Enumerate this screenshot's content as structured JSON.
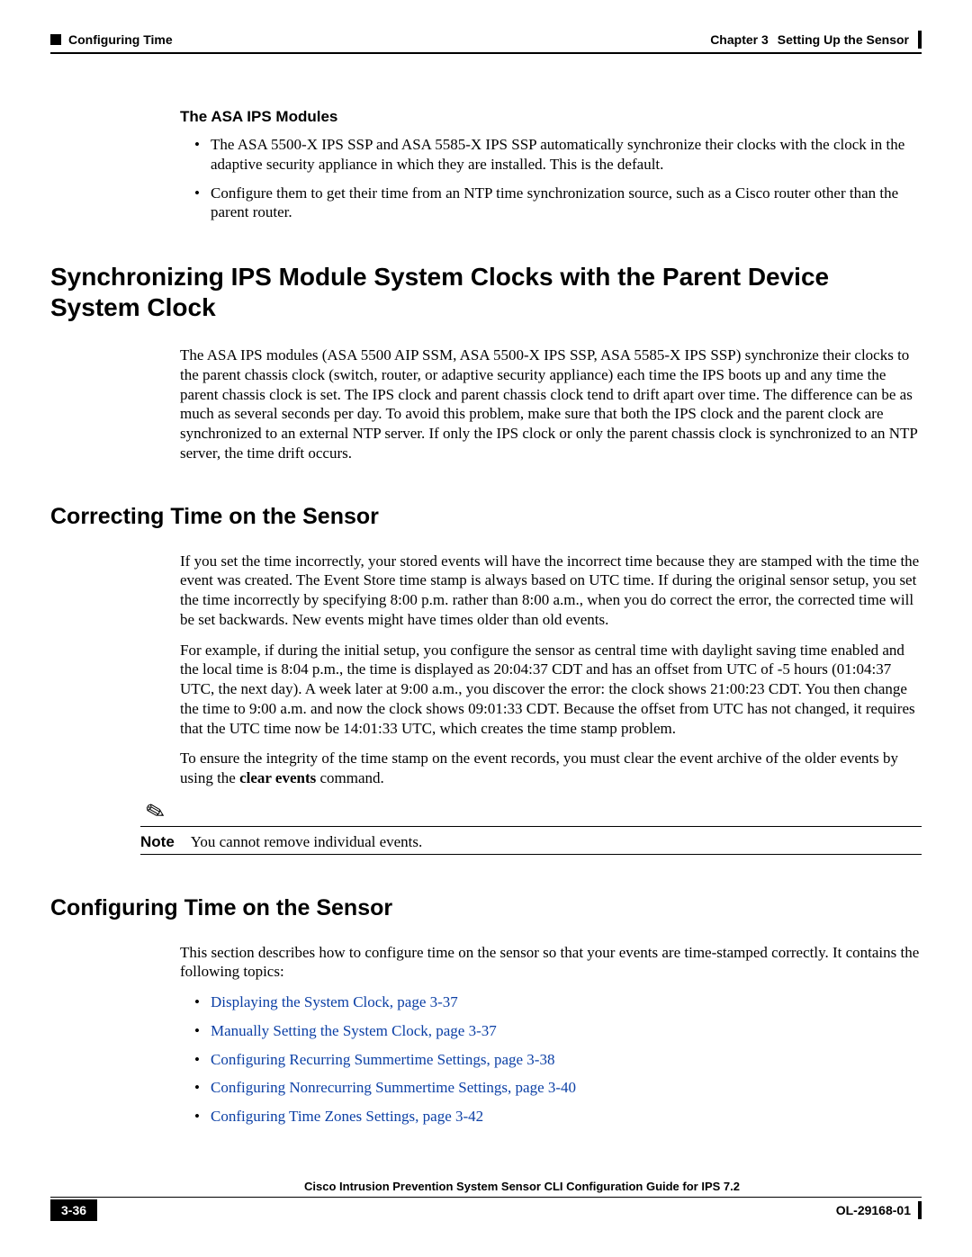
{
  "header": {
    "left_marker": "Configuring Time",
    "chapter_label": "Chapter 3",
    "chapter_title": "Setting Up the Sensor"
  },
  "asa_section": {
    "heading": "The ASA IPS Modules",
    "bullets": [
      "The ASA 5500-X IPS SSP and ASA 5585-X IPS SSP automatically synchronize their clocks with the clock in the adaptive security appliance in which they are installed. This is the default.",
      "Configure them to get their time from an NTP time synchronization source, such as a Cisco router other than the parent router."
    ]
  },
  "sync_section": {
    "heading": "Synchronizing IPS Module System Clocks with the Parent Device System Clock",
    "para": "The ASA IPS modules (ASA 5500 AIP SSM, ASA 5500-X IPS SSP, ASA 5585-X IPS SSP) synchronize their clocks to the parent chassis clock (switch, router, or adaptive security appliance) each time the IPS boots up and any time the parent chassis clock is set. The IPS clock and parent chassis clock tend to drift apart over time. The difference can be as much as several seconds per day. To avoid this problem, make sure that both the IPS clock and the parent clock are synchronized to an external NTP server. If only the IPS clock or only the parent chassis clock is synchronized to an NTP server, the time drift occurs."
  },
  "correcting_section": {
    "heading": "Correcting Time on the Sensor",
    "para1": "If you set the time incorrectly, your stored events will have the incorrect time because they are stamped with the time the event was created. The Event Store time stamp is always based on UTC time. If during the original sensor setup, you set the time incorrectly by specifying 8:00 p.m. rather than 8:00 a.m., when you do correct the error, the corrected time will be set backwards. New events might have times older than old events.",
    "para2": "For example, if during the initial setup, you configure the sensor as central time with daylight saving time enabled and the local time is 8:04 p.m., the time is displayed as 20:04:37 CDT and has an offset from UTC of -5 hours (01:04:37 UTC, the next day). A week later at 9:00 a.m., you discover the error: the clock shows 21:00:23 CDT. You then change the time to 9:00 a.m. and now the clock shows 09:01:33 CDT. Because the offset from UTC has not changed, it requires that the UTC time now be 14:01:33 UTC, which creates the time stamp problem.",
    "para3_pre": "To ensure the integrity of the time stamp on the event records, you must clear the event archive of the older events by using the ",
    "para3_bold": "clear events",
    "para3_post": " command.",
    "note_label": "Note",
    "note_text": "You cannot remove individual events."
  },
  "config_section": {
    "heading": "Configuring Time on the Sensor",
    "intro": "This section describes how to configure time on the sensor so that your events are time-stamped correctly. It contains the following topics:",
    "links": [
      "Displaying the System Clock, page 3-37",
      "Manually Setting the System Clock, page 3-37",
      "Configuring Recurring Summertime Settings, page 3-38",
      "Configuring Nonrecurring Summertime Settings, page 3-40",
      "Configuring Time Zones Settings, page 3-42"
    ]
  },
  "footer": {
    "guide_title": "Cisco Intrusion Prevention System Sensor CLI Configuration Guide for IPS 7.2",
    "page_number": "3-36",
    "doc_id": "OL-29168-01"
  }
}
